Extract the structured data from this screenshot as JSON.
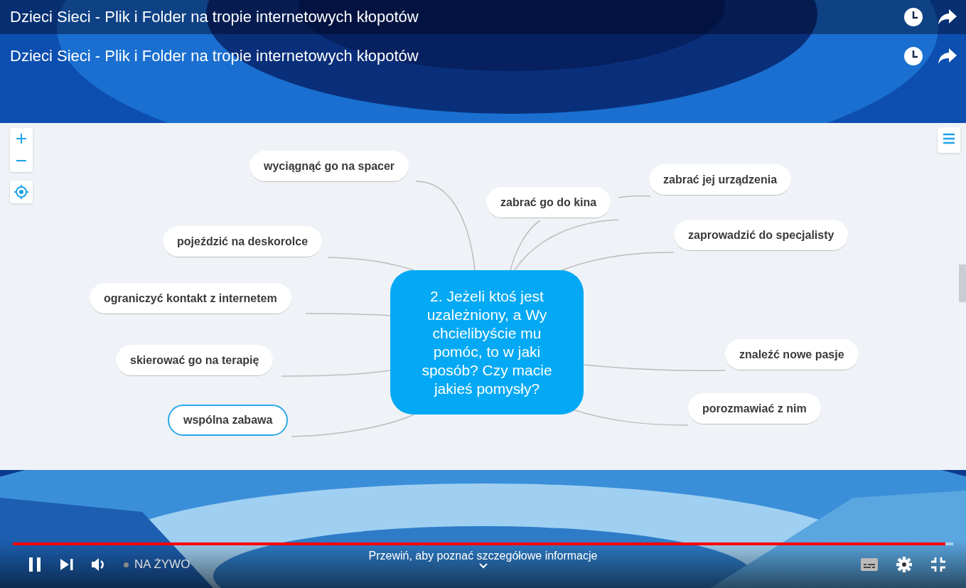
{
  "player": {
    "title": "Dzieci Sieci - Plik i Folder na tropie internetowych kłopotów",
    "progress": {
      "level": 0.992
    },
    "live_label": "NA ŻYWO",
    "hint": "Przewiń, aby poznać szczegółowe informacje"
  },
  "video": {
    "title": "Dzieci Sieci - Plik i Folder na tropie internetowych kłopotów",
    "mind_map": {
      "central_topic": "2. Jeżeli ktoś jest uzależniony, a Wy chcielibyście mu pomóc, to w jaki sposób? Czy macie jakieś pomysły?",
      "topics": [
        {
          "label": "wyciągnąć go na spacer",
          "selected": false
        },
        {
          "label": "pojeździć na deskorolce",
          "selected": false
        },
        {
          "label": "ograniczyć kontakt z internetem",
          "selected": false
        },
        {
          "label": "skierować go na terapię",
          "selected": false
        },
        {
          "label": "wspólna zabawa",
          "selected": true
        },
        {
          "label": "zabrać go do kina",
          "selected": false,
          "children": [
            {
              "label": "zabrać jej urządzenia",
              "selected": false
            }
          ]
        },
        {
          "label": "zaprowadzić do specjalisty",
          "selected": false
        },
        {
          "label": "znaleźć nowe pasje",
          "selected": false
        },
        {
          "label": "porozmawiać z nim",
          "selected": false
        }
      ]
    }
  }
}
